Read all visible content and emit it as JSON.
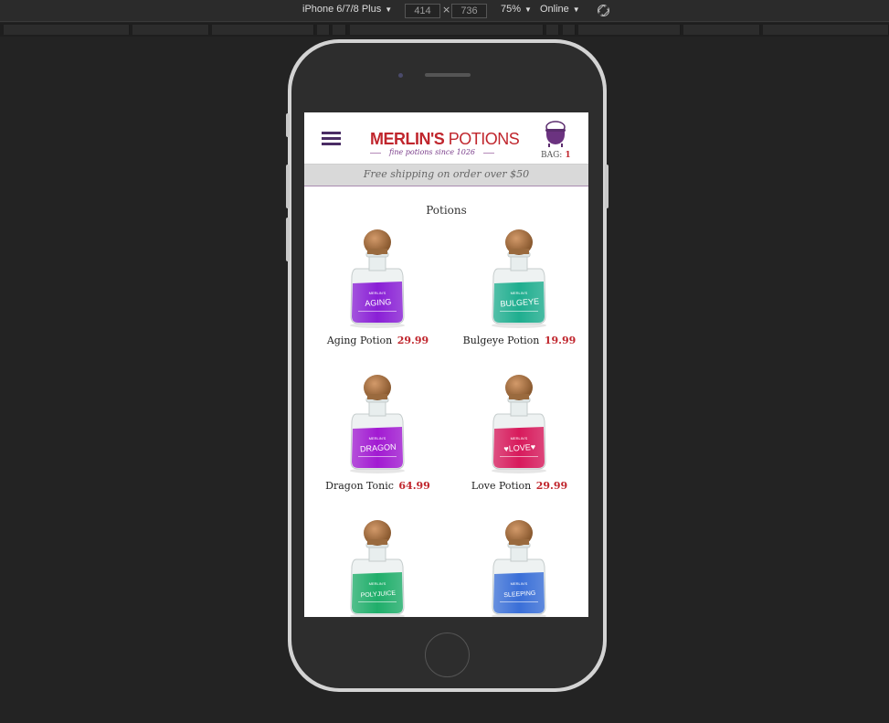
{
  "devtools": {
    "device": "iPhone 6/7/8 Plus",
    "width": "414",
    "height": "736",
    "zoom": "75%",
    "network": "Online"
  },
  "header": {
    "logo_word1": "MERLIN'S",
    "logo_word2": "POTIONS",
    "tagline": "fine potions since 1026",
    "bag_label": "BAG:",
    "bag_count": "1"
  },
  "promo": "Free shipping on order over $50",
  "section_title": "Potions",
  "products": [
    {
      "name": "Aging Potion",
      "price": "29.99",
      "label": "AGING",
      "liquid": "#8a1fd6"
    },
    {
      "name": "Bulgeye Potion",
      "price": "19.99",
      "label": "BULGEYE",
      "liquid": "#1fae8f"
    },
    {
      "name": "Dragon Tonic",
      "price": "64.99",
      "label": "DRAGON",
      "liquid": "#a21ad2"
    },
    {
      "name": "Love Potion",
      "price": "29.99",
      "label": "♥LOVE♥",
      "liquid": "#d81a5c"
    },
    {
      "name": "",
      "price": "",
      "label": "POLYJUICE",
      "liquid": "#1fae6a"
    },
    {
      "name": "",
      "price": "",
      "label": "SLEEPING",
      "liquid": "#3a6fd8"
    }
  ],
  "colors": {
    "brand_red": "#c0262d",
    "brand_purple": "#4a2c64"
  }
}
